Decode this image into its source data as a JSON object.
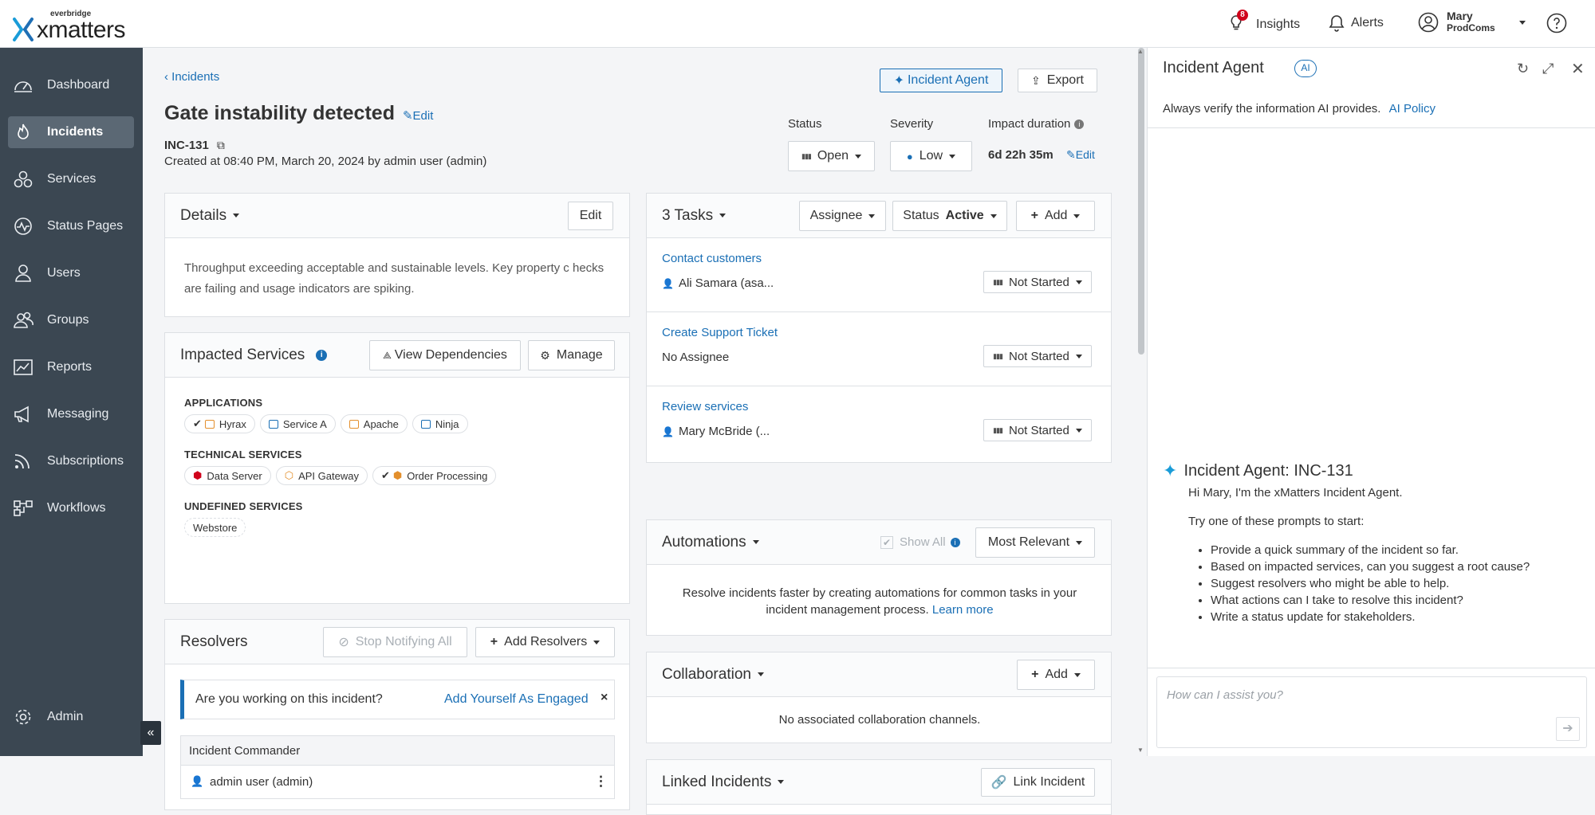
{
  "brand": {
    "small": "everbridge",
    "name": "xmatters"
  },
  "topbar": {
    "insights_label": "Insights",
    "insights_badge": "8",
    "alerts_label": "Alerts",
    "user_name": "Mary",
    "user_org": "ProdComs"
  },
  "sidebar": {
    "items": [
      {
        "label": "Dashboard",
        "icon": "dashboard-icon"
      },
      {
        "label": "Incidents",
        "icon": "incidents-icon",
        "active": true
      },
      {
        "label": "Services",
        "icon": "services-icon"
      },
      {
        "label": "Status Pages",
        "icon": "status-pages-icon"
      },
      {
        "label": "Users",
        "icon": "users-icon"
      },
      {
        "label": "Groups",
        "icon": "groups-icon"
      },
      {
        "label": "Reports",
        "icon": "reports-icon"
      },
      {
        "label": "Messaging",
        "icon": "messaging-icon"
      },
      {
        "label": "Subscriptions",
        "icon": "subscriptions-icon"
      },
      {
        "label": "Workflows",
        "icon": "workflows-icon"
      }
    ],
    "admin_label": "Admin",
    "collapse": "«"
  },
  "incident": {
    "breadcrumb": "Incidents",
    "title": "Gate instability detected",
    "edit_label": "Edit",
    "id": "INC-131",
    "created": "Created at 08:40 PM, March 20, 2024 by admin user (admin)",
    "incident_agent_btn": "Incident Agent",
    "export_btn": "Export",
    "status_label": "Status",
    "status_value": "Open",
    "severity_label": "Severity",
    "severity_value": "Low",
    "impact_label": "Impact duration",
    "impact_value": "6d 22h 35m",
    "impact_edit": "Edit"
  },
  "details": {
    "title": "Details",
    "edit": "Edit",
    "text": "Throughput exceeding acceptable and sustainable levels. Key property c hecks are failing and usage indicators are spiking."
  },
  "impacted": {
    "title": "Impacted Services",
    "view_deps": "View Dependencies",
    "manage": "Manage",
    "applications_label": "APPLICATIONS",
    "applications": [
      "Hyrax",
      "Service A",
      "Apache",
      "Ninja"
    ],
    "technical_label": "TECHNICAL SERVICES",
    "technical": [
      "Data Server",
      "API Gateway",
      "Order Processing"
    ],
    "undefined_label": "UNDEFINED SERVICES",
    "undefined": [
      "Webstore"
    ]
  },
  "resolvers": {
    "title": "Resolvers",
    "stop": "Stop Notifying All",
    "add": "Add Resolvers",
    "question": "Are you working on this incident?",
    "add_yourself": "Add Yourself As Engaged",
    "commander_label": "Incident Commander",
    "commander": "admin user (admin)"
  },
  "tasks": {
    "title": "3 Tasks",
    "assignee": "Assignee",
    "status_label": "Status",
    "status_value": "Active",
    "add": "Add",
    "rows": [
      {
        "title": "Contact customers",
        "user": "Ali Samara (asa...",
        "status": "Not Started"
      },
      {
        "title": "Create Support Ticket",
        "user": "No Assignee",
        "status": "Not Started"
      },
      {
        "title": "Review services",
        "user": "Mary McBride (...",
        "status": "Not Started"
      }
    ]
  },
  "automations": {
    "title": "Automations",
    "show_all": "Show All",
    "sort": "Most Relevant",
    "text": "Resolve incidents faster by creating automations for common tasks in your incident management process.",
    "learn_more": "Learn more"
  },
  "collaboration": {
    "title": "Collaboration",
    "add": "Add",
    "empty": "No associated collaboration channels."
  },
  "linked": {
    "title": "Linked Incidents",
    "link_btn": "Link Incident"
  },
  "agent": {
    "title": "Incident Agent",
    "ai_badge": "AI",
    "notice": "Always verify the information AI provides.",
    "policy": "AI Policy",
    "heading": "Incident Agent: INC-131",
    "greeting": "Hi Mary, I'm the xMatters Incident Agent.",
    "try": "Try one of these prompts to start:",
    "prompts": [
      "Provide a quick summary of the incident so far.",
      "Based on impacted services, can you suggest a root cause?",
      "Suggest resolvers who might be able to help.",
      "What actions can I take to resolve this incident?",
      "Write a status update for stakeholders."
    ],
    "input_placeholder": "How can I assist you?"
  },
  "colors": {
    "sidebar": "#3b4752",
    "link": "#1a6fb5",
    "accent": "#1a6fb5"
  }
}
